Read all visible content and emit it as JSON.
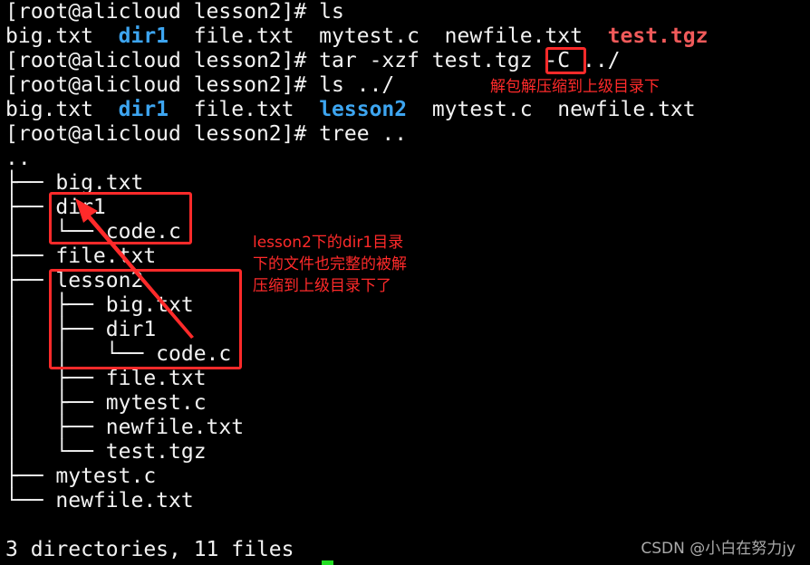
{
  "terminal": {
    "lines": [
      [
        {
          "t": "[root@alicloud lesson2]# ls"
        }
      ],
      [
        {
          "t": "big.txt  "
        },
        {
          "t": "dir1",
          "c": "dir"
        },
        {
          "t": "  file.txt  mytest.c  newfile.txt  "
        },
        {
          "t": "test.tgz",
          "c": "arc"
        }
      ],
      [
        {
          "t": "[root@alicloud lesson2]# tar -xzf test.tgz -C ../"
        }
      ],
      [
        {
          "t": "[root@alicloud lesson2]# ls ../"
        }
      ],
      [
        {
          "t": "big.txt  "
        },
        {
          "t": "dir1",
          "c": "dir"
        },
        {
          "t": "  file.txt  "
        },
        {
          "t": "lesson2",
          "c": "dir"
        },
        {
          "t": "  mytest.c  newfile.txt"
        }
      ],
      [
        {
          "t": "[root@alicloud lesson2]# tree .."
        }
      ],
      [
        {
          "t": ".."
        }
      ],
      [
        {
          "t": "├── big.txt"
        }
      ],
      [
        {
          "t": "├── dir1"
        }
      ],
      [
        {
          "t": "│   └── code.c"
        }
      ],
      [
        {
          "t": "├── file.txt"
        }
      ],
      [
        {
          "t": "├── lesson2"
        }
      ],
      [
        {
          "t": "│   ├── big.txt"
        }
      ],
      [
        {
          "t": "│   ├── dir1"
        }
      ],
      [
        {
          "t": "│   │   └── code.c"
        }
      ],
      [
        {
          "t": "│   ├── file.txt"
        }
      ],
      [
        {
          "t": "│   ├── mytest.c"
        }
      ],
      [
        {
          "t": "│   ├── newfile.txt"
        }
      ],
      [
        {
          "t": "│   └── test.tgz"
        }
      ],
      [
        {
          "t": "├── mytest.c"
        }
      ],
      [
        {
          "t": "└── newfile.txt"
        }
      ],
      [
        {
          "t": ""
        }
      ],
      [
        {
          "t": "3 directories, 11 files"
        }
      ]
    ]
  },
  "annotations": {
    "flag_note": "解包解压缩到上级目录下",
    "tree_note": "lesson2下的dir1目录\n下的文件也完整的被解\n压缩到上级目录下了",
    "color": "#ff2a2a"
  },
  "watermark": "CSDN @小白在努力jy"
}
